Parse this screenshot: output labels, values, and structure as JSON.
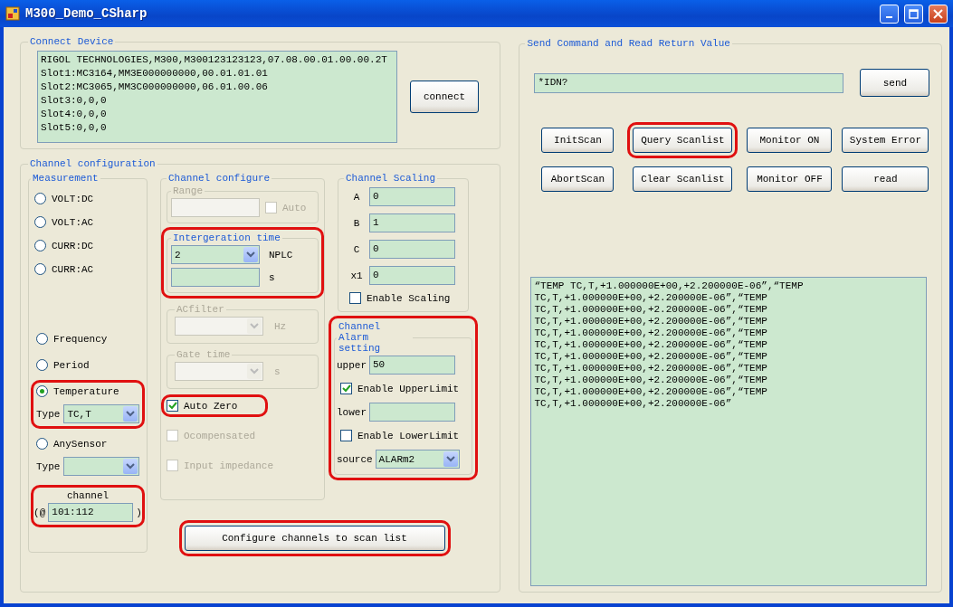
{
  "window": {
    "title": "M300_Demo_CSharp"
  },
  "connect_device": {
    "title": "Connect Device",
    "info_lines": [
      "RIGOL TECHNOLOGIES,M300,M300123123123,07.08.00.01.00.00.2T",
      "Slot1:MC3164,MM3E000000000,00.01.01.01",
      "Slot2:MC3065,MM3C000000000,06.01.00.06",
      "Slot3:0,0,0",
      "Slot4:0,0,0",
      "Slot5:0,0,0"
    ],
    "button": "connect"
  },
  "channel_configuration": {
    "title": "Channel configuration",
    "measurement": {
      "title": "Measurement",
      "options_top": [
        {
          "label": "VOLT:DC",
          "selected": false
        },
        {
          "label": "VOLT:AC",
          "selected": false
        },
        {
          "label": "CURR:DC",
          "selected": false
        },
        {
          "label": "CURR:AC",
          "selected": false
        }
      ],
      "options_bottom": [
        {
          "label": "Frequency",
          "selected": false,
          "highlighted": false
        },
        {
          "label": "Period",
          "selected": false,
          "highlighted": false
        },
        {
          "label": "Temperature",
          "selected": true,
          "highlighted": true,
          "type": {
            "label": "Type",
            "value": "TC,T"
          }
        },
        {
          "label": "AnySensor",
          "selected": false,
          "highlighted": false,
          "type": {
            "label": "Type"
          }
        }
      ],
      "channel": {
        "label": "channel",
        "prefix": "(@",
        "value": "101:112",
        "suffix": ")",
        "highlighted": true
      }
    },
    "channel_configure": {
      "title": "Channel configure",
      "range": {
        "title": "Range",
        "disabled": true,
        "auto": {
          "label": "Auto",
          "checked": false
        }
      },
      "integration": {
        "title": "Intergeration time",
        "highlighted": true,
        "value": "2",
        "unit": "NPLC",
        "seconds_unit": "s"
      },
      "acfilter": {
        "title": "ACfilter",
        "disabled": true,
        "unit": "Hz"
      },
      "gate_time": {
        "title": "Gate time",
        "disabled": true,
        "unit": "s"
      },
      "checks": [
        {
          "label": "Auto Zero",
          "checked": true,
          "disabled": false,
          "highlighted": true
        },
        {
          "label": "Ocompensated",
          "checked": false,
          "disabled": true,
          "highlighted": false
        },
        {
          "label": "Input impedance",
          "checked": false,
          "disabled": true,
          "highlighted": false
        }
      ]
    },
    "channel_scaling": {
      "title": "Channel Scaling",
      "fields": [
        {
          "label": "A",
          "value": "0"
        },
        {
          "label": "B",
          "value": "1"
        },
        {
          "label": "C",
          "value": "0"
        },
        {
          "label": "x1",
          "value": "0"
        }
      ],
      "enable": {
        "label": "Enable Scaling",
        "checked": false
      }
    },
    "alarm": {
      "title": "Channel Alarm setting",
      "highlighted": true,
      "upper": {
        "label": "upper",
        "value": "50"
      },
      "enable_upper": {
        "label": "Enable UpperLimit",
        "checked": true
      },
      "lower": {
        "label": "lower"
      },
      "enable_lower": {
        "label": "Enable LowerLimit",
        "checked": false
      },
      "source": {
        "label": "source",
        "value": "ALARm2"
      }
    },
    "configure_button": {
      "label": "Configure channels to scan list",
      "highlighted": true
    }
  },
  "send_command": {
    "title": "Send Command and Read Return Value",
    "command": "*IDN?",
    "send_button": "send",
    "buttons": [
      {
        "label": "InitScan",
        "highlighted": false
      },
      {
        "label": "Query Scanlist",
        "highlighted": true
      },
      {
        "label": "Monitor ON",
        "highlighted": false
      },
      {
        "label": "System Error",
        "highlighted": false
      },
      {
        "label": "AbortScan",
        "highlighted": false
      },
      {
        "label": "Clear Scanlist",
        "highlighted": false
      },
      {
        "label": "Monitor OFF",
        "highlighted": false
      },
      {
        "label": "read",
        "highlighted": false
      }
    ],
    "output_lines": [
      "“TEMP TC,T,+1.000000E+00,+2.200000E-06”,“TEMP",
      "TC,T,+1.000000E+00,+2.200000E-06”,“TEMP",
      "TC,T,+1.000000E+00,+2.200000E-06”,“TEMP",
      "TC,T,+1.000000E+00,+2.200000E-06”,“TEMP",
      "TC,T,+1.000000E+00,+2.200000E-06”,“TEMP",
      "TC,T,+1.000000E+00,+2.200000E-06”,“TEMP",
      "TC,T,+1.000000E+00,+2.200000E-06”,“TEMP",
      "TC,T,+1.000000E+00,+2.200000E-06”,“TEMP",
      "TC,T,+1.000000E+00,+2.200000E-06”,“TEMP",
      "TC,T,+1.000000E+00,+2.200000E-06”,“TEMP",
      "TC,T,+1.000000E+00,+2.200000E-06”"
    ]
  }
}
